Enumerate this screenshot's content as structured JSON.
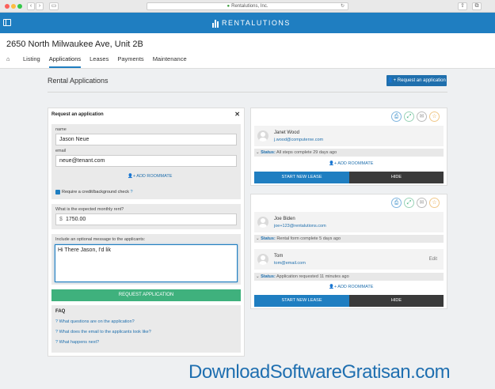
{
  "browser": {
    "url": "Rentalutions, Inc."
  },
  "app": {
    "logo_text": "RENTALUTIONS"
  },
  "property": {
    "title": "2650 North Milwaukee Ave, Unit 2B"
  },
  "tabs": [
    {
      "label": "Listing"
    },
    {
      "label": "Applications",
      "active": true
    },
    {
      "label": "Leases"
    },
    {
      "label": "Payments"
    },
    {
      "label": "Maintenance"
    }
  ],
  "page": {
    "section_title": "Rental Applications",
    "request_button": "Request an application"
  },
  "request_form": {
    "title": "Request an application",
    "name_label": "name",
    "name_value": "Jason Neue",
    "email_label": "email",
    "email_value": "neue@tenant.com",
    "add_roommate": "ADD ROOMMATE",
    "check_label": "Require a credit/background check",
    "rent_label": "What is the expected monthly rent?",
    "rent_prefix": "$",
    "rent_value": "1750.00",
    "message_label": "Include an optional message to the applicants:",
    "message_value": "Hi There Jason, I'd lik",
    "submit": "REQUEST APPLICATION",
    "faq_title": "FAQ",
    "faq": [
      "What questions are on the application?",
      "What does the email to the applicants look like?",
      "What happens next?"
    ]
  },
  "applications": [
    {
      "applicants": [
        {
          "name": "Janet Wood",
          "email": "j.wood@computerxe.com",
          "status_key": "Status:",
          "status": "All steps complete",
          "time": "29 days ago"
        }
      ],
      "add_roommate": "ADD ROOMMATE",
      "lease_button": "START NEW LEASE",
      "hide_button": "HIDE"
    },
    {
      "applicants": [
        {
          "name": "Joe Biden",
          "email": "joe+123@rentalutions.com",
          "status_key": "Status:",
          "status": "Rental form complete",
          "time": "5 days ago"
        },
        {
          "name": "Tom",
          "email": "tom@email.com",
          "status_key": "Status:",
          "status": "Application requested",
          "time": "11 minutes ago",
          "edit": "Edit"
        }
      ],
      "add_roommate": "ADD ROOMMATE",
      "lease_button": "START NEW LEASE",
      "hide_button": "HIDE"
    }
  ],
  "watermark": "DownloadSoftwareGratisan.com",
  "colors": {
    "brand": "#1f7ec1",
    "primary_button": "#1f6fad",
    "success": "#3fb17d",
    "dark": "#3a3a3a"
  }
}
